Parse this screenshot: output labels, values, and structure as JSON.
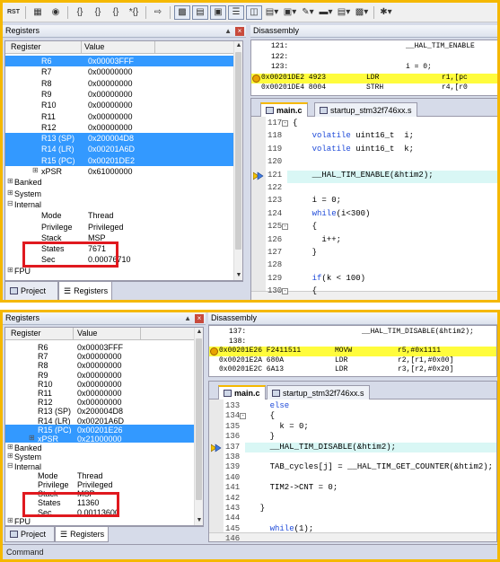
{
  "top": {
    "toolbar": {
      "rst_label": "RST"
    },
    "registers_title": "Registers",
    "disassembly_title": "Disassembly",
    "columns": {
      "register": "Register",
      "value": "Value"
    },
    "rows": [
      {
        "name": "R6",
        "value": "0x00003FFF",
        "selected": true
      },
      {
        "name": "R7",
        "value": "0x00000000"
      },
      {
        "name": "R8",
        "value": "0x00000000"
      },
      {
        "name": "R9",
        "value": "0x00000000"
      },
      {
        "name": "R10",
        "value": "0x00000000"
      },
      {
        "name": "R11",
        "value": "0x00000000"
      },
      {
        "name": "R12",
        "value": "0x00000000"
      },
      {
        "name": "R13 (SP)",
        "value": "0x200004D8",
        "selected": true
      },
      {
        "name": "R14 (LR)",
        "value": "0x00201A6D",
        "selected": true
      },
      {
        "name": "R15 (PC)",
        "value": "0x00201DE2",
        "selected": true
      },
      {
        "name": "xPSR",
        "value": "0x61000000",
        "tree": "+"
      },
      {
        "name": "Banked",
        "value": "",
        "tree": "+",
        "level": 0
      },
      {
        "name": "System",
        "value": "",
        "tree": "+",
        "level": 0
      },
      {
        "name": "Internal",
        "value": "",
        "tree": "-",
        "level": 0
      },
      {
        "name": "Mode",
        "value": "Thread"
      },
      {
        "name": "Privilege",
        "value": "Privileged"
      },
      {
        "name": "Stack",
        "value": "MSP"
      },
      {
        "name": "States",
        "value": "7671"
      },
      {
        "name": "Sec",
        "value": "0.00076710"
      },
      {
        "name": "FPU",
        "value": "",
        "tree": "+",
        "level": 0
      }
    ],
    "bottom_tabs": {
      "project": "Project",
      "registers": "Registers"
    },
    "disasm": [
      {
        "a": "121:",
        "b": "__HAL_TIM_ENABLE",
        "c": ""
      },
      {
        "a": "122:",
        "b": "",
        "c": ""
      },
      {
        "a": "123:",
        "b": "i = 0;",
        "c": ""
      },
      {
        "a": "0x00201DE2 4923",
        "b": "LDR",
        "c": "r1,[pc",
        "hl": true
      },
      {
        "a": "0x00201DE4 8004",
        "b": "STRH",
        "c": "r4,[r0"
      }
    ],
    "editor_tabs": {
      "main": "main.c",
      "startup": "startup_stm32f746xx.s"
    },
    "code": [
      {
        "n": "117",
        "t": "{",
        "fold": "-"
      },
      {
        "n": "118",
        "t": "    volatile uint16_t  i;"
      },
      {
        "n": "119",
        "t": "    volatile uint16_t  k;"
      },
      {
        "n": "120",
        "t": ""
      },
      {
        "n": "121",
        "t": "    __HAL_TIM_ENABLE(&htim2);",
        "cur": true
      },
      {
        "n": "122",
        "t": ""
      },
      {
        "n": "123",
        "t": "    i = 0;"
      },
      {
        "n": "124",
        "t": "    while(i<300)"
      },
      {
        "n": "125",
        "t": "    {",
        "fold": "-"
      },
      {
        "n": "126",
        "t": "      i++;"
      },
      {
        "n": "127",
        "t": "    }"
      },
      {
        "n": "128",
        "t": ""
      },
      {
        "n": "129",
        "t": "    if(k < 100)"
      },
      {
        "n": "130",
        "t": "    {",
        "fold": "-"
      }
    ]
  },
  "bottom": {
    "registers_title": "Registers",
    "disassembly_title": "Disassembly",
    "columns": {
      "register": "Register",
      "value": "Value"
    },
    "rows": [
      {
        "name": "R6",
        "value": "0x00003FFF"
      },
      {
        "name": "R7",
        "value": "0x00000000"
      },
      {
        "name": "R8",
        "value": "0x00000000"
      },
      {
        "name": "R9",
        "value": "0x00000000"
      },
      {
        "name": "R10",
        "value": "0x00000000"
      },
      {
        "name": "R11",
        "value": "0x00000000"
      },
      {
        "name": "R12",
        "value": "0x00000000"
      },
      {
        "name": "R13 (SP)",
        "value": "0x200004D8"
      },
      {
        "name": "R14 (LR)",
        "value": "0x00201A6D"
      },
      {
        "name": "R15 (PC)",
        "value": "0x00201E26",
        "selected": true
      },
      {
        "name": "xPSR",
        "value": "0x21000000",
        "tree": "+",
        "selected": true
      },
      {
        "name": "Banked",
        "value": "",
        "tree": "+",
        "level": 0
      },
      {
        "name": "System",
        "value": "",
        "tree": "+",
        "level": 0
      },
      {
        "name": "Internal",
        "value": "",
        "tree": "-",
        "level": 0
      },
      {
        "name": "Mode",
        "value": "Thread"
      },
      {
        "name": "Privilege",
        "value": "Privileged"
      },
      {
        "name": "Stack",
        "value": "MSP"
      },
      {
        "name": "States",
        "value": "11360"
      },
      {
        "name": "Sec",
        "value": "0.00113600"
      },
      {
        "name": "FPU",
        "value": "",
        "tree": "+",
        "level": 0
      }
    ],
    "bottom_tabs": {
      "project": "Project",
      "registers": "Registers"
    },
    "command_label": "Command",
    "disasm": [
      {
        "a": "137:",
        "b": "__HAL_TIM_DISABLE(&htim2);",
        "c": ""
      },
      {
        "a": "138:",
        "b": "",
        "c": ""
      },
      {
        "a": "0x00201E26 F2411511",
        "b": "MOVW",
        "c": "r5,#0x1111",
        "hl": true
      },
      {
        "a": "0x00201E2A 680A",
        "b": "LDR",
        "c": "r2,[r1,#0x00]"
      },
      {
        "a": "0x00201E2C 6A13",
        "b": "LDR",
        "c": "r3,[r2,#0x20]"
      }
    ],
    "editor_tabs": {
      "main": "main.c",
      "startup": "startup_stm32f746xx.s"
    },
    "code": [
      {
        "n": "133",
        "t": "    else"
      },
      {
        "n": "134",
        "t": "    {",
        "fold": "-"
      },
      {
        "n": "135",
        "t": "      k = 0;"
      },
      {
        "n": "136",
        "t": "    }"
      },
      {
        "n": "137",
        "t": "    __HAL_TIM_DISABLE(&htim2);",
        "cur": true
      },
      {
        "n": "138",
        "t": ""
      },
      {
        "n": "139",
        "t": "    TAB_cycles[j] = __HAL_TIM_GET_COUNTER(&htim2);"
      },
      {
        "n": "140",
        "t": ""
      },
      {
        "n": "141",
        "t": "    TIM2->CNT = 0;"
      },
      {
        "n": "142",
        "t": ""
      },
      {
        "n": "143",
        "t": "  }"
      },
      {
        "n": "144",
        "t": ""
      },
      {
        "n": "145",
        "t": "    while(1);"
      },
      {
        "n": "146",
        "t": ""
      }
    ]
  }
}
